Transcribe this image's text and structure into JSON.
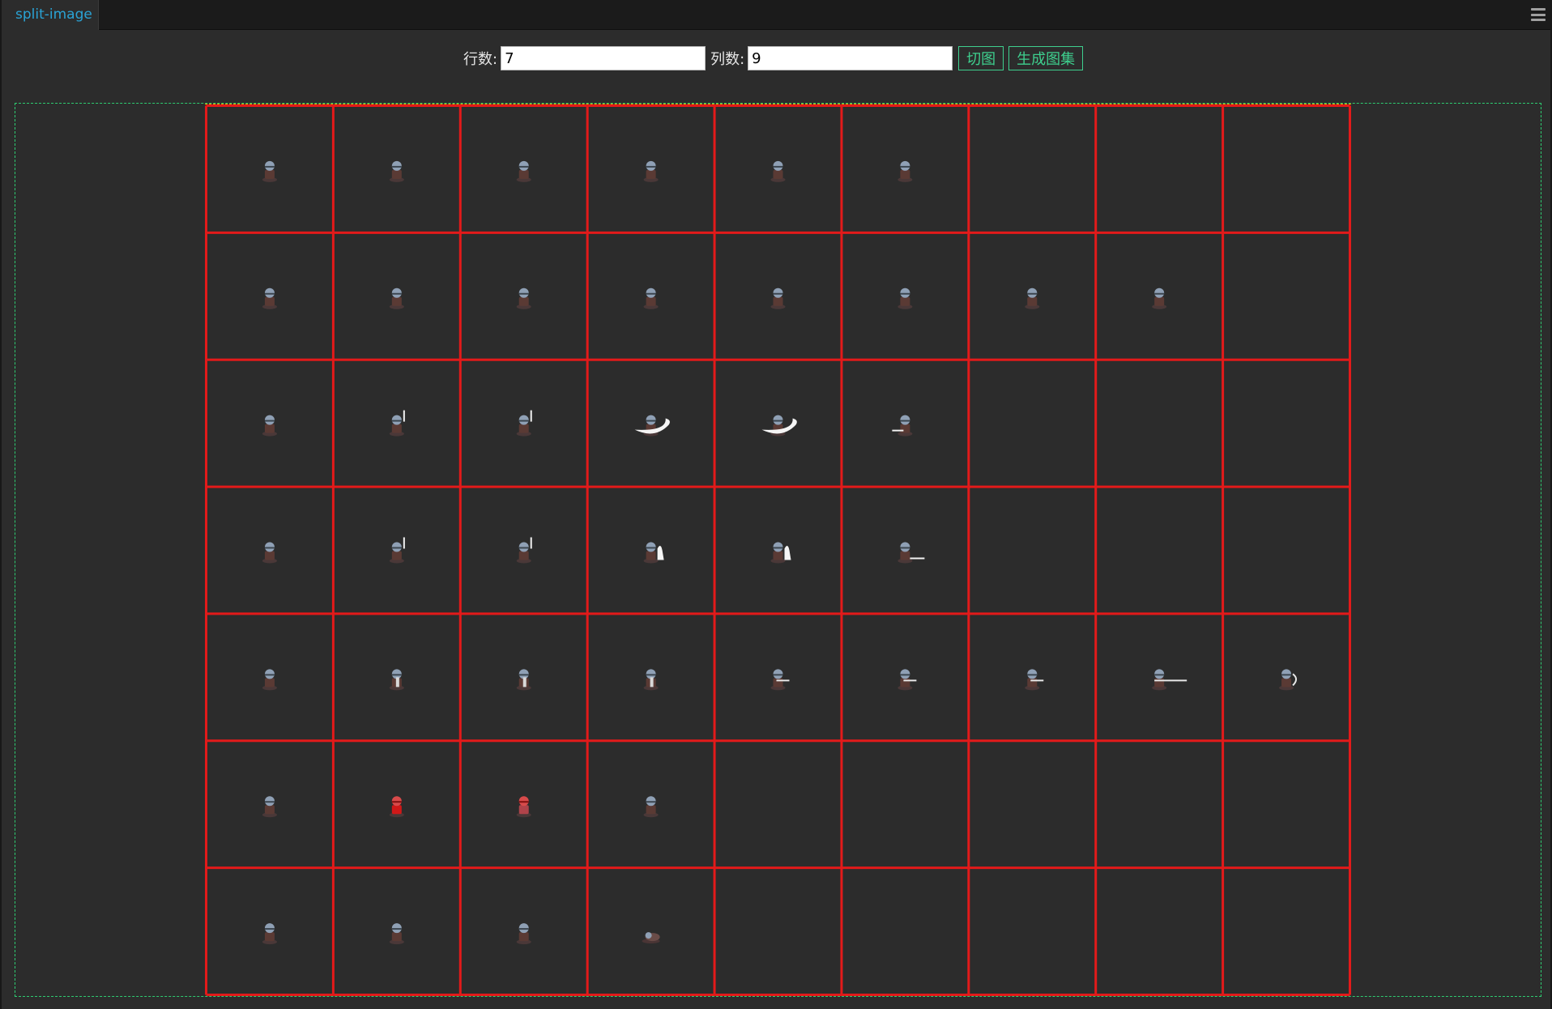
{
  "tab": {
    "title": "split-image"
  },
  "toolbar": {
    "rows_label": "行数:",
    "rows_value": "7",
    "cols_label": "列数:",
    "cols_value": "9",
    "split_button": "切图",
    "atlas_button": "生成图集"
  },
  "colors": {
    "grid_line": "#e31a1a",
    "canvas_border": "#2ecc71",
    "tab_text": "#2aa3d5",
    "button_accent": "#3ecf8e"
  },
  "grid": {
    "rows": 7,
    "cols": 9,
    "frames": [
      [
        "idle",
        "idle",
        "idle",
        "idle",
        "idle",
        "idle",
        "",
        "",
        ""
      ],
      [
        "idle",
        "idle",
        "idle",
        "idle",
        "idle",
        "idle",
        "idle",
        "idle",
        ""
      ],
      [
        "idle",
        "raise",
        "raise",
        "slash",
        "slash",
        "stab",
        "",
        "",
        ""
      ],
      [
        "idle",
        "raise",
        "raise",
        "wave",
        "wave",
        "thrust",
        "",
        "",
        ""
      ],
      [
        "idle",
        "shield",
        "shield",
        "shield",
        "spear",
        "spear",
        "spear",
        "spear-long",
        "burst"
      ],
      [
        "idle",
        "hurt",
        "hurt-fade",
        "idle",
        "",
        "",
        "",
        "",
        ""
      ],
      [
        "idle",
        "idle",
        "crouch",
        "down",
        "",
        "",
        "",
        "",
        ""
      ]
    ]
  }
}
